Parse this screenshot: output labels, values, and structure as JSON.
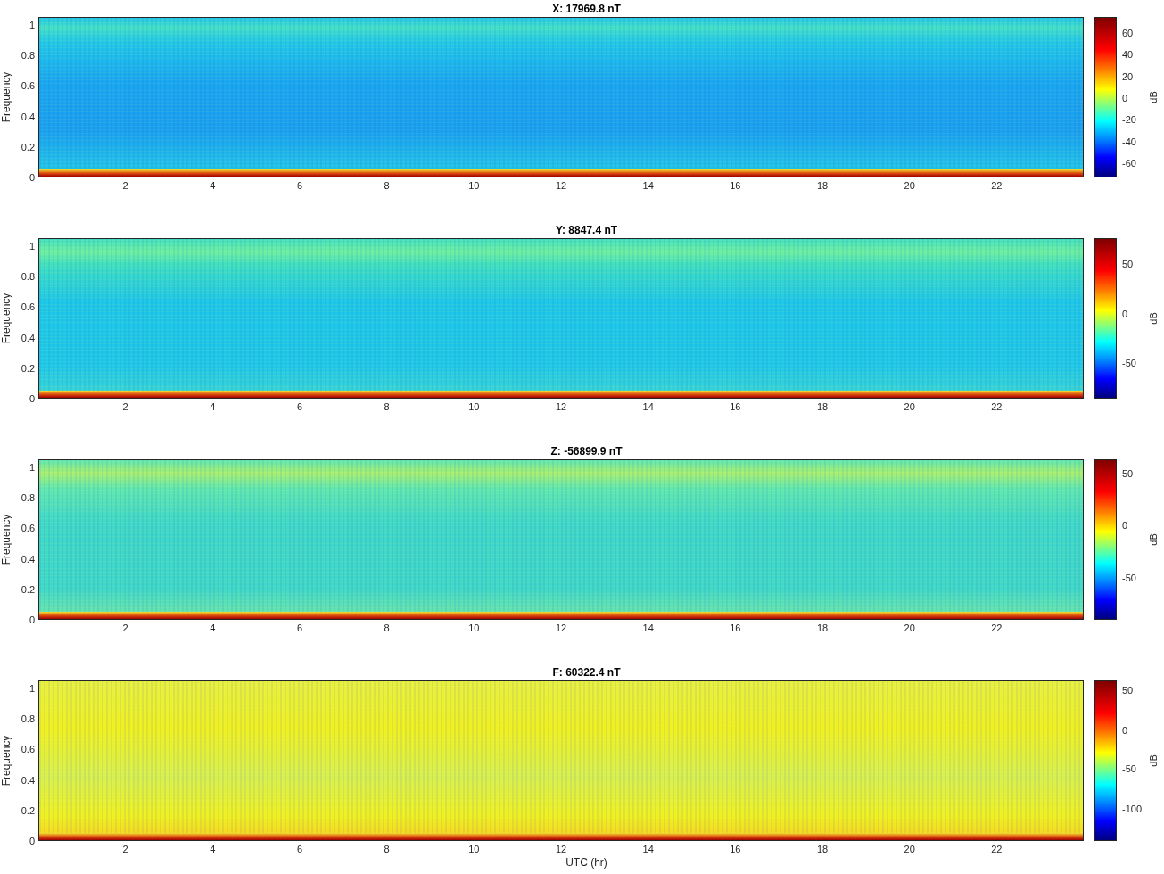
{
  "panels": [
    {
      "title": "X: 17969.8 nT",
      "ylabel": "Frequency",
      "y_ticks": [
        "1",
        "0.8",
        "0.6",
        "0.4",
        "0.2",
        "0"
      ],
      "x_ticks": [
        "2",
        "4",
        "6",
        "8",
        "10",
        "12",
        "14",
        "16",
        "18",
        "20",
        "22"
      ],
      "colorbar": {
        "ticks": [
          "60",
          "40",
          "20",
          "0",
          "-20",
          "-40",
          "-60"
        ],
        "label": "dB"
      }
    },
    {
      "title": "Y: 8847.4 nT",
      "ylabel": "Frequency",
      "y_ticks": [
        "1",
        "0.8",
        "0.6",
        "0.4",
        "0.2",
        "0"
      ],
      "x_ticks": [
        "2",
        "4",
        "6",
        "8",
        "10",
        "12",
        "14",
        "16",
        "18",
        "20",
        "22"
      ],
      "colorbar": {
        "ticks": [
          "50",
          "0",
          "-50"
        ],
        "label": "dB"
      }
    },
    {
      "title": "Z: -56899.9 nT",
      "ylabel": "Frequency",
      "y_ticks": [
        "1",
        "0.8",
        "0.6",
        "0.4",
        "0.2",
        "0"
      ],
      "x_ticks": [
        "2",
        "4",
        "6",
        "8",
        "10",
        "12",
        "14",
        "16",
        "18",
        "20",
        "22"
      ],
      "colorbar": {
        "ticks": [
          "50",
          "0",
          "-50"
        ],
        "label": "dB"
      }
    },
    {
      "title": "F: 60322.4 nT",
      "ylabel": "Frequency",
      "y_ticks": [
        "1",
        "0.8",
        "0.6",
        "0.4",
        "0.2",
        "0"
      ],
      "x_ticks": [
        "2",
        "4",
        "6",
        "8",
        "10",
        "12",
        "14",
        "16",
        "18",
        "20",
        "22"
      ],
      "colorbar": {
        "ticks": [
          "50",
          "0",
          "-50",
          "-100"
        ],
        "label": "dB"
      }
    }
  ],
  "xlabel": "UTC (hr)"
}
